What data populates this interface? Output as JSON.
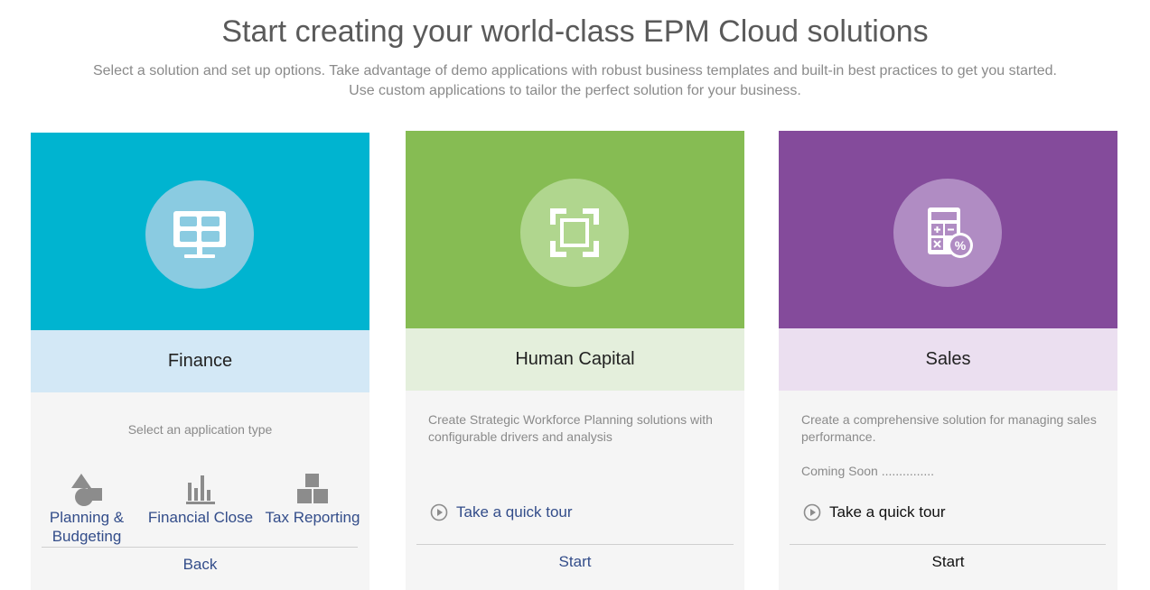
{
  "header": {
    "title": "Start creating your world-class EPM Cloud solutions",
    "subtitle": "Select a solution and set up options. Take advantage of demo applications with robust business templates and built-in best practices to get you started. Use custom applications to tailor the perfect solution for your business."
  },
  "cards": {
    "finance": {
      "name": "Finance",
      "accent": "#00b4d0",
      "icon": "monitor-dashboard-icon",
      "select_label": "Select an application type",
      "app_types": [
        {
          "label_line1": "Planning &",
          "label_line2": "Budgeting",
          "icon": "shapes-icon"
        },
        {
          "label": "Financial Close",
          "icon": "bar-chart-icon"
        },
        {
          "label": "Tax Reporting",
          "icon": "stacked-boxes-icon"
        }
      ],
      "back_label": "Back"
    },
    "human_capital": {
      "name": "Human Capital",
      "accent": "#86bc53",
      "icon": "frame-focus-icon",
      "description": "Create Strategic Workforce Planning solutions with configurable drivers and analysis",
      "tour_label": "Take a quick tour",
      "start_label": "Start"
    },
    "sales": {
      "name": "Sales",
      "accent": "#844b9b",
      "icon": "calculator-percent-icon",
      "description": "Create a comprehensive solution for managing sales performance.",
      "coming_soon": "Coming Soon ...............",
      "tour_label": "Take a quick tour",
      "start_label": "Start"
    }
  }
}
